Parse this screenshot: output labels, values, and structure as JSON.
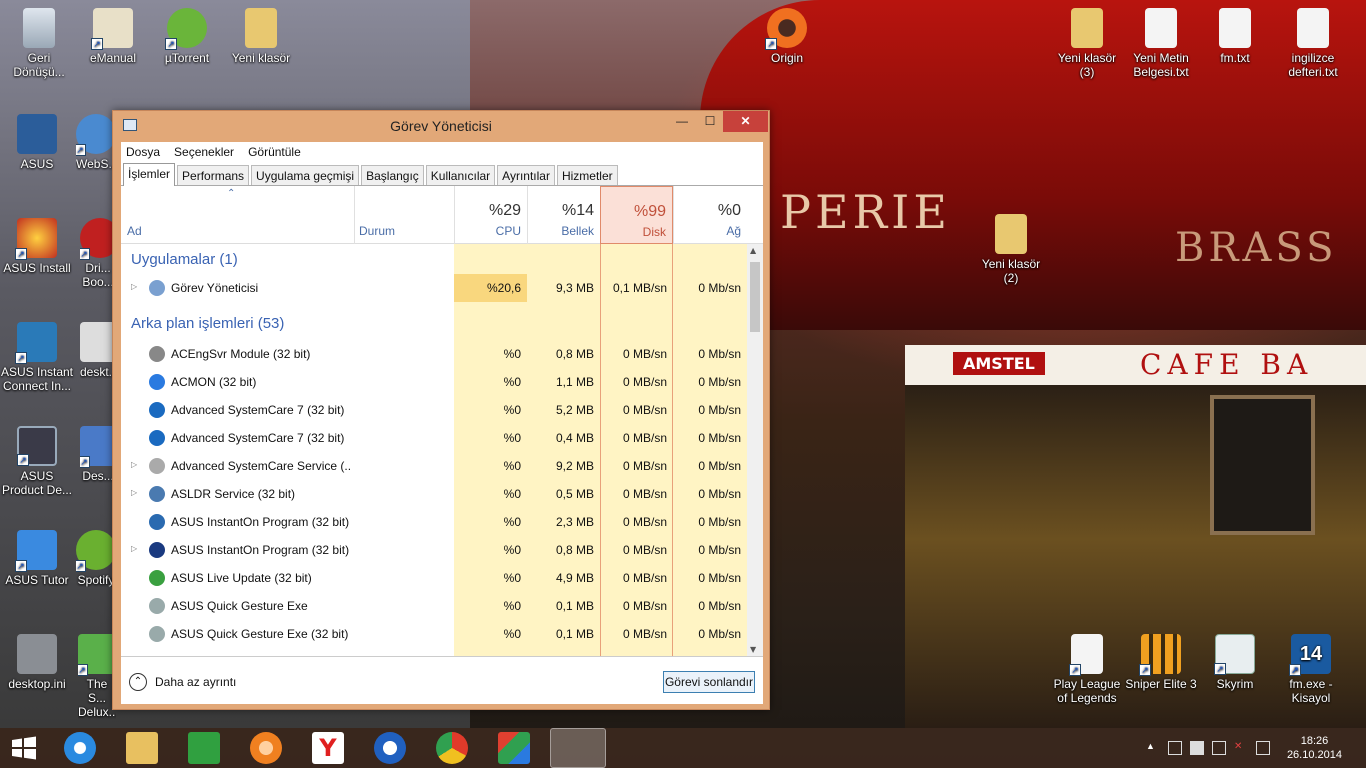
{
  "desktop": {
    "icons_left": [
      {
        "label": "Geri Dönüşü...",
        "icon": "recycle-bin-icon"
      },
      {
        "label": "eManual",
        "icon": "emanual-icon"
      },
      {
        "label": "µTorrent",
        "icon": "utorrent-icon"
      },
      {
        "label": "Yeni klasör",
        "icon": "folder-icon"
      },
      {
        "label": "ASUS",
        "icon": "asus-icon"
      },
      {
        "label": "WebS...",
        "icon": "websurf-icon"
      },
      {
        "label": "ASUS Install",
        "icon": "asus-install-icon"
      },
      {
        "label": "Dri... Boo...",
        "icon": "driver-booster-icon"
      },
      {
        "label": "ASUS Instant Connect In...",
        "icon": "asus-instant-connect-icon"
      },
      {
        "label": "deskt...",
        "icon": "desktop-file-icon"
      },
      {
        "label": "ASUS Product De...",
        "icon": "asus-product-icon"
      },
      {
        "label": "Des...",
        "icon": "desktop-icon"
      },
      {
        "label": "ASUS Tutor",
        "icon": "asus-tutor-icon"
      },
      {
        "label": "Spotify",
        "icon": "spotify-icon"
      },
      {
        "label": "desktop.ini",
        "icon": "ini-file-icon"
      },
      {
        "label": "The S... Delux...",
        "icon": "sims-icon"
      }
    ],
    "icons_right": [
      {
        "label": "Origin",
        "icon": "origin-icon"
      },
      {
        "label": "Yeni klasör (3)",
        "icon": "folder-icon"
      },
      {
        "label": "Yeni Metin Belgesi.txt",
        "icon": "text-file-icon"
      },
      {
        "label": "fm.txt",
        "icon": "text-file-icon"
      },
      {
        "label": "ingilizce defteri.txt",
        "icon": "text-file-icon"
      },
      {
        "label": "Yeni klasör (2)",
        "icon": "folder-icon"
      },
      {
        "label": "Play League of Legends",
        "icon": "lol-icon"
      },
      {
        "label": "Sniper Elite 3",
        "icon": "sniper-elite-icon"
      },
      {
        "label": "Skyrim",
        "icon": "skyrim-icon"
      },
      {
        "label": "fm.exe - Kisayol",
        "icon": "fm-exe-icon"
      }
    ],
    "scenery": {
      "awning_text": "PERIE",
      "awning_text2": "BRASS",
      "amstel": "AMSTEL",
      "cafe": "CAFE  BA"
    }
  },
  "window": {
    "title": "Görev Yöneticisi",
    "min": "—",
    "max": "☐",
    "close": "✕",
    "menu": [
      "Dosya",
      "Seçenekler",
      "Görüntüle"
    ],
    "tabs": [
      "İşlemler",
      "Performans",
      "Uygulama geçmişi",
      "Başlangıç",
      "Kullanıcılar",
      "Ayrıntılar",
      "Hizmetler"
    ],
    "columns": {
      "name": "Ad",
      "status": "Durum",
      "cpu": {
        "pct": "%29",
        "label": "CPU"
      },
      "mem": {
        "pct": "%14",
        "label": "Bellek"
      },
      "disk": {
        "pct": "%99",
        "label": "Disk"
      },
      "net": {
        "pct": "%0",
        "label": "Ağ"
      }
    },
    "groups": {
      "apps": "Uygulamalar (1)",
      "bg": "Arka plan işlemleri (53)"
    },
    "app_rows": [
      {
        "name": "Görev Yöneticisi",
        "cpu": "%20,6",
        "mem": "9,3 MB",
        "disk": "0,1 MB/sn",
        "net": "0 Mb/sn",
        "expandable": true,
        "icon": "task-manager-icon"
      }
    ],
    "bg_rows": [
      {
        "name": "ACEngSvr Module (32 bit)",
        "cpu": "%0",
        "mem": "0,8 MB",
        "disk": "0 MB/sn",
        "net": "0 Mb/sn",
        "expandable": false,
        "icon": "acengsvr-icon"
      },
      {
        "name": "ACMON (32 bit)",
        "cpu": "%0",
        "mem": "1,1 MB",
        "disk": "0 MB/sn",
        "net": "0 Mb/sn",
        "expandable": false,
        "icon": "acmon-icon"
      },
      {
        "name": "Advanced SystemCare 7 (32 bit)",
        "cpu": "%0",
        "mem": "5,2 MB",
        "disk": "0 MB/sn",
        "net": "0 Mb/sn",
        "expandable": false,
        "icon": "systemcare-icon"
      },
      {
        "name": "Advanced SystemCare 7 (32 bit)",
        "cpu": "%0",
        "mem": "0,4 MB",
        "disk": "0 MB/sn",
        "net": "0 Mb/sn",
        "expandable": false,
        "icon": "systemcare-icon"
      },
      {
        "name": "Advanced SystemCare Service (...",
        "cpu": "%0",
        "mem": "9,2 MB",
        "disk": "0 MB/sn",
        "net": "0 Mb/sn",
        "expandable": true,
        "icon": "service-icon"
      },
      {
        "name": "ASLDR Service (32 bit)",
        "cpu": "%0",
        "mem": "0,5 MB",
        "disk": "0 MB/sn",
        "net": "0 Mb/sn",
        "expandable": true,
        "icon": "window-app-icon"
      },
      {
        "name": "ASUS InstantOn Program (32 bit)",
        "cpu": "%0",
        "mem": "2,3 MB",
        "disk": "0 MB/sn",
        "net": "0 Mb/sn",
        "expandable": false,
        "icon": "asus-instanton-icon"
      },
      {
        "name": "ASUS InstantOn Program (32 bit)",
        "cpu": "%0",
        "mem": "0,8 MB",
        "disk": "0 MB/sn",
        "net": "0 Mb/sn",
        "expandable": true,
        "icon": "asus-instanton2-icon"
      },
      {
        "name": "ASUS Live Update (32 bit)",
        "cpu": "%0",
        "mem": "4,9 MB",
        "disk": "0 MB/sn",
        "net": "0 Mb/sn",
        "expandable": false,
        "icon": "live-update-icon"
      },
      {
        "name": "ASUS Quick Gesture Exe",
        "cpu": "%0",
        "mem": "0,1 MB",
        "disk": "0 MB/sn",
        "net": "0 Mb/sn",
        "expandable": false,
        "icon": "gesture-icon"
      },
      {
        "name": "ASUS Quick Gesture Exe (32 bit)",
        "cpu": "%0",
        "mem": "0,1 MB",
        "disk": "0 MB/sn",
        "net": "0 Mb/sn",
        "expandable": false,
        "icon": "gesture-icon"
      }
    ],
    "footer": {
      "less": "Daha az ayrıntı",
      "end_task": "Görevi sonlandır"
    }
  },
  "taskbar": {
    "apps": [
      "start-icon",
      "internet-explorer-icon",
      "file-explorer-icon",
      "store-icon",
      "origin-taskbar-icon",
      "yandex-icon",
      "ccleaner-icon",
      "chrome-icon",
      "paint-icon",
      "task-manager-icon"
    ],
    "clock_time": "18:26",
    "clock_date": "26.10.2014"
  },
  "colors": {
    "accent": "#3a63b3",
    "disk_highlight": "#fbe0d7",
    "cpu_col": "#fff4c4",
    "close": "#c7413b"
  }
}
